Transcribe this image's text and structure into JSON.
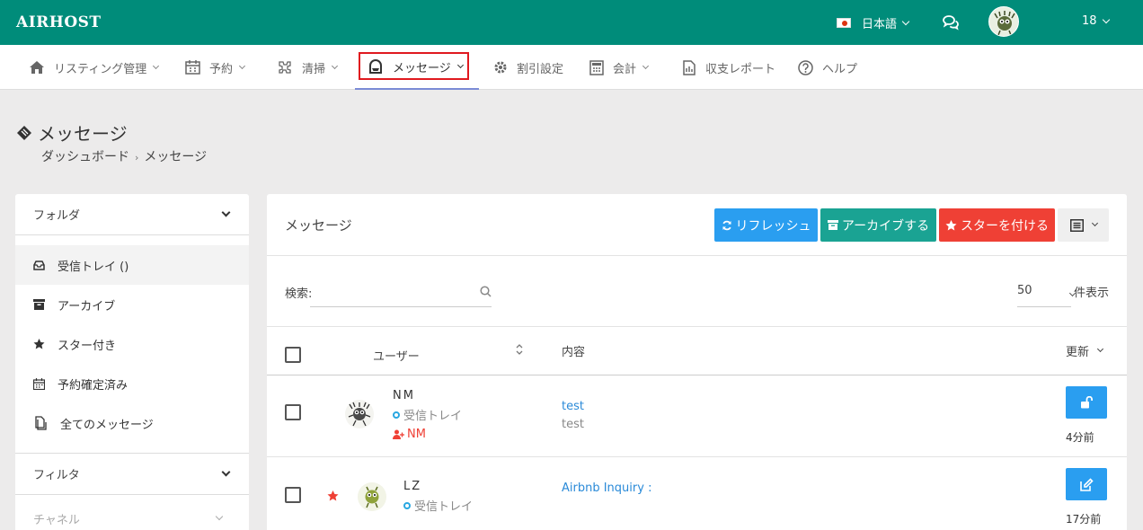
{
  "header": {
    "logo": "AIRHOST",
    "language": "日本語",
    "user_count": "18",
    "colors": {
      "header_bg": "#008c7a",
      "accent_blue": "#2a9ef0",
      "accent_red": "#ef4035",
      "accent_teal": "#1aa393"
    }
  },
  "nav": {
    "items": [
      {
        "label": "リスティング管理",
        "icon": "home-icon"
      },
      {
        "label": "予約",
        "icon": "calendar-icon"
      },
      {
        "label": "清掃",
        "icon": "cleaning-icon"
      },
      {
        "label": "メッセージ",
        "icon": "inbox-icon",
        "active": true
      },
      {
        "label": "割引設定",
        "icon": "gear-icon"
      },
      {
        "label": "会計",
        "icon": "calculator-icon"
      },
      {
        "label": "収支レポート",
        "icon": "report-icon"
      },
      {
        "label": "ヘルプ",
        "icon": "help-icon"
      }
    ]
  },
  "page": {
    "title": "メッセージ",
    "breadcrumb": [
      "ダッシュボード",
      "›",
      "メッセージ"
    ]
  },
  "sidebar": {
    "folder_header": "フォルダ",
    "items": [
      {
        "label": "受信トレイ ()",
        "icon": "inbox-icon",
        "active": true
      },
      {
        "label": "アーカイブ",
        "icon": "archive-icon"
      },
      {
        "label": "スター付き",
        "icon": "star-icon"
      },
      {
        "label": "予約確定済み",
        "icon": "calendar-icon"
      },
      {
        "label": "全てのメッセージ",
        "icon": "copy-icon"
      }
    ],
    "filter_header": "フィルタ",
    "channel_header": "チャネル"
  },
  "main": {
    "title": "メッセージ",
    "buttons": {
      "refresh": "リフレッシュ",
      "archive": "アーカイブする",
      "star": "スターを付ける"
    },
    "search": {
      "label": "検索:",
      "value": ""
    },
    "per_page": {
      "value": "50",
      "label": "件表示"
    },
    "columns": {
      "user": "ユーザー",
      "content": "内容",
      "updated": "更新"
    },
    "rows": [
      {
        "name": "NM",
        "folder": "受信トレイ",
        "assignee": "NM",
        "starred": false,
        "subject": "test",
        "preview": "test",
        "action_icon": "unlock-icon",
        "time": "4分前"
      },
      {
        "name": "LZ",
        "folder": "受信トレイ",
        "starred": true,
        "subject": "Airbnb Inquiry :",
        "preview": "",
        "action_icon": "edit-icon",
        "time": "17分前"
      }
    ]
  }
}
